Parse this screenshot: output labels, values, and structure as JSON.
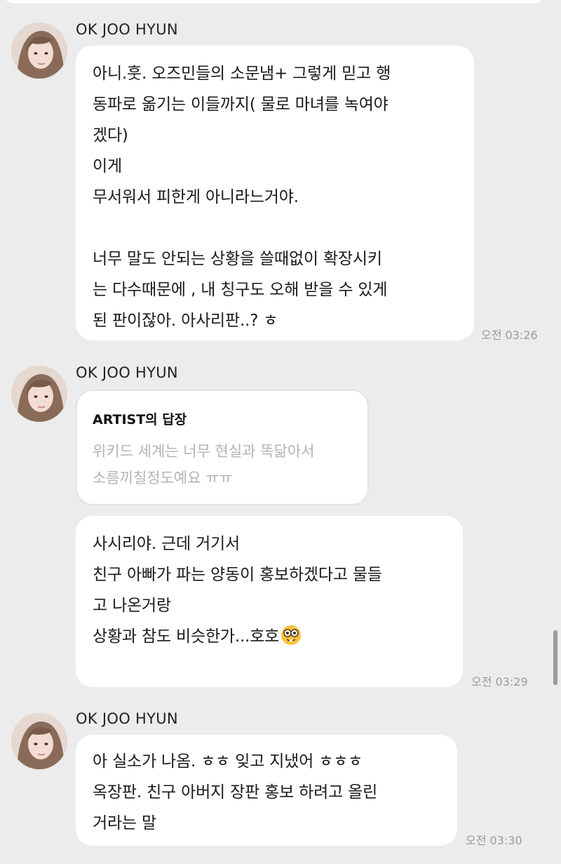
{
  "messages": [
    {
      "sender": "OK JOO HYUN",
      "lines": [
        "아니.훗. 오즈민들의 소문냄+ 그렇게 믿고 행",
        "동파로 옮기는 이들까지( 물로 마녀를 녹여야",
        "겠다)",
        "이게",
        "무서워서 피한게 아니라느거야.",
        "",
        "너무 말도 안되는 상황을 쓸때없이 확장시키",
        "는 다수때문에 , 내 칭구도 오해 받을 수 있게",
        "된 판이잖아. 아사리판..? ㅎ"
      ],
      "time": "오전 03:26"
    },
    {
      "sender": "OK JOO HYUN",
      "reply": {
        "heading": "ARTIST의 답장",
        "lines": [
          "위키드 세계는 너무 현실과 똑닮아서",
          "소름끼칠정도예요 ㅠㅠ"
        ]
      },
      "lines": [
        "사시리야. 근데 거기서",
        "친구 아빠가 파는 양동이 홍보하겠다고 물들",
        "고 나온거랑",
        "상황과 참도 비슷한가...호호"
      ],
      "emoji": "nerd-face-emoji",
      "time": "오전 03:29"
    },
    {
      "sender": "OK JOO HYUN",
      "lines": [
        "아 실소가 나옴. ㅎㅎ 잊고 지냈어 ㅎㅎㅎ",
        "옥장판. 친구 아버지 장판 홍보 하려고 올린",
        "거라는 말"
      ],
      "time": "오전 03:30"
    }
  ],
  "colors": {
    "background": "#ececec",
    "bubble": "#ffffff",
    "timestamp": "#9a9a9a",
    "reply_text": "#b3b3b3"
  }
}
